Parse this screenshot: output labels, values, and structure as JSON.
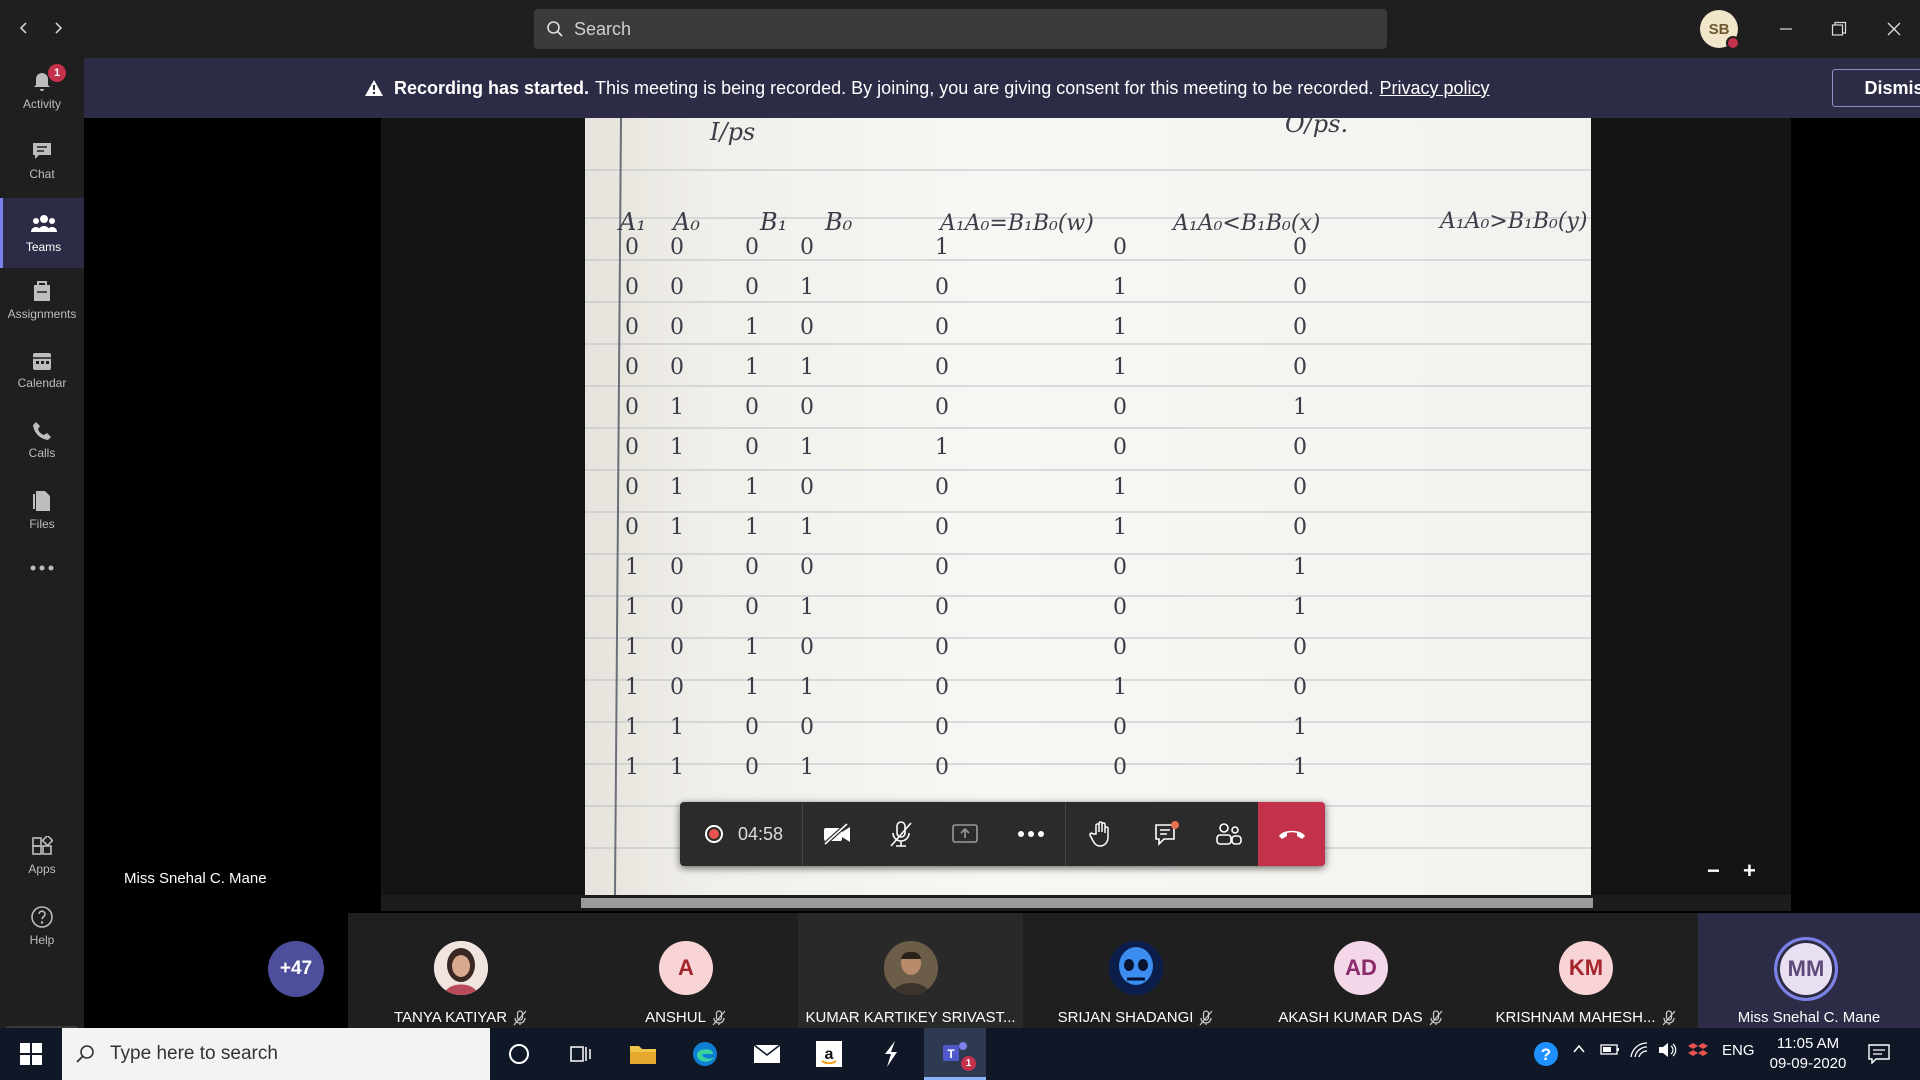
{
  "app": {
    "search_placeholder": "Search",
    "user_initials": "SB"
  },
  "rail": {
    "items": [
      {
        "label": "Activity",
        "badge": "1"
      },
      {
        "label": "Chat"
      },
      {
        "label": "Teams"
      },
      {
        "label": "Assignments"
      },
      {
        "label": "Calendar"
      },
      {
        "label": "Calls"
      },
      {
        "label": "Files"
      },
      {
        "label": "Apps"
      },
      {
        "label": "Help"
      }
    ]
  },
  "banner": {
    "title": "Recording has started.",
    "message": "This meeting is being recorded. By joining, you are giving consent for this meeting to be recorded.",
    "link": "Privacy policy",
    "dismiss_label": "Dismiss"
  },
  "content": {
    "headers": [
      "I/ps",
      "O/ps."
    ],
    "columns": [
      "A₁",
      "A₀",
      "B₁",
      "B₀",
      "A₁A₀=B₁B₀(w)",
      "A₁A₀<B₁B₀(x)",
      "A₁A₀>B₁B₀(y)"
    ],
    "rows": [
      [
        "0",
        "0",
        "0",
        "0",
        "1",
        "0",
        "0"
      ],
      [
        "0",
        "0",
        "0",
        "1",
        "0",
        "1",
        "0"
      ],
      [
        "0",
        "0",
        "1",
        "0",
        "0",
        "1",
        "0"
      ],
      [
        "0",
        "0",
        "1",
        "1",
        "0",
        "1",
        "0"
      ],
      [
        "0",
        "1",
        "0",
        "0",
        "0",
        "0",
        "1"
      ],
      [
        "0",
        "1",
        "0",
        "1",
        "1",
        "0",
        "0"
      ],
      [
        "0",
        "1",
        "1",
        "0",
        "0",
        "1",
        "0"
      ],
      [
        "0",
        "1",
        "1",
        "1",
        "0",
        "1",
        "0"
      ],
      [
        "1",
        "0",
        "0",
        "0",
        "0",
        "0",
        "1"
      ],
      [
        "1",
        "0",
        "0",
        "1",
        "0",
        "0",
        "1"
      ],
      [
        "1",
        "0",
        "1",
        "0",
        "0",
        "0",
        "0"
      ],
      [
        "1",
        "0",
        "1",
        "1",
        "0",
        "1",
        "0"
      ],
      [
        "1",
        "1",
        "0",
        "0",
        "0",
        "0",
        "1"
      ],
      [
        "1",
        "1",
        "0",
        "1",
        "0",
        "0",
        "1"
      ]
    ],
    "presenter": "Miss Snehal C. Mane",
    "zoom_out": "−",
    "zoom_in": "+"
  },
  "controls": {
    "timer": "04:58"
  },
  "participants": {
    "overflow": "+47",
    "people": [
      {
        "name": "TANYA KATIYAR",
        "initials": "",
        "muted": true
      },
      {
        "name": "ANSHUL",
        "initials": "A",
        "muted": true
      },
      {
        "name": "KUMAR KARTIKEY SRIVAST...",
        "initials": "",
        "muted": false
      },
      {
        "name": "SRIJAN SHADANGI",
        "initials": "",
        "muted": true
      },
      {
        "name": "AKASH KUMAR DAS",
        "initials": "AD",
        "muted": true
      },
      {
        "name": "KRISHNAM MAHESH...",
        "initials": "KM",
        "muted": true
      },
      {
        "name": "Miss Snehal C. Mane",
        "initials": "MM",
        "muted": false
      }
    ]
  },
  "taskbar": {
    "search_placeholder": "Type here to search",
    "teams_badge": "1",
    "language": "ENG",
    "time": "11:05 AM",
    "date": "09-09-2020"
  }
}
